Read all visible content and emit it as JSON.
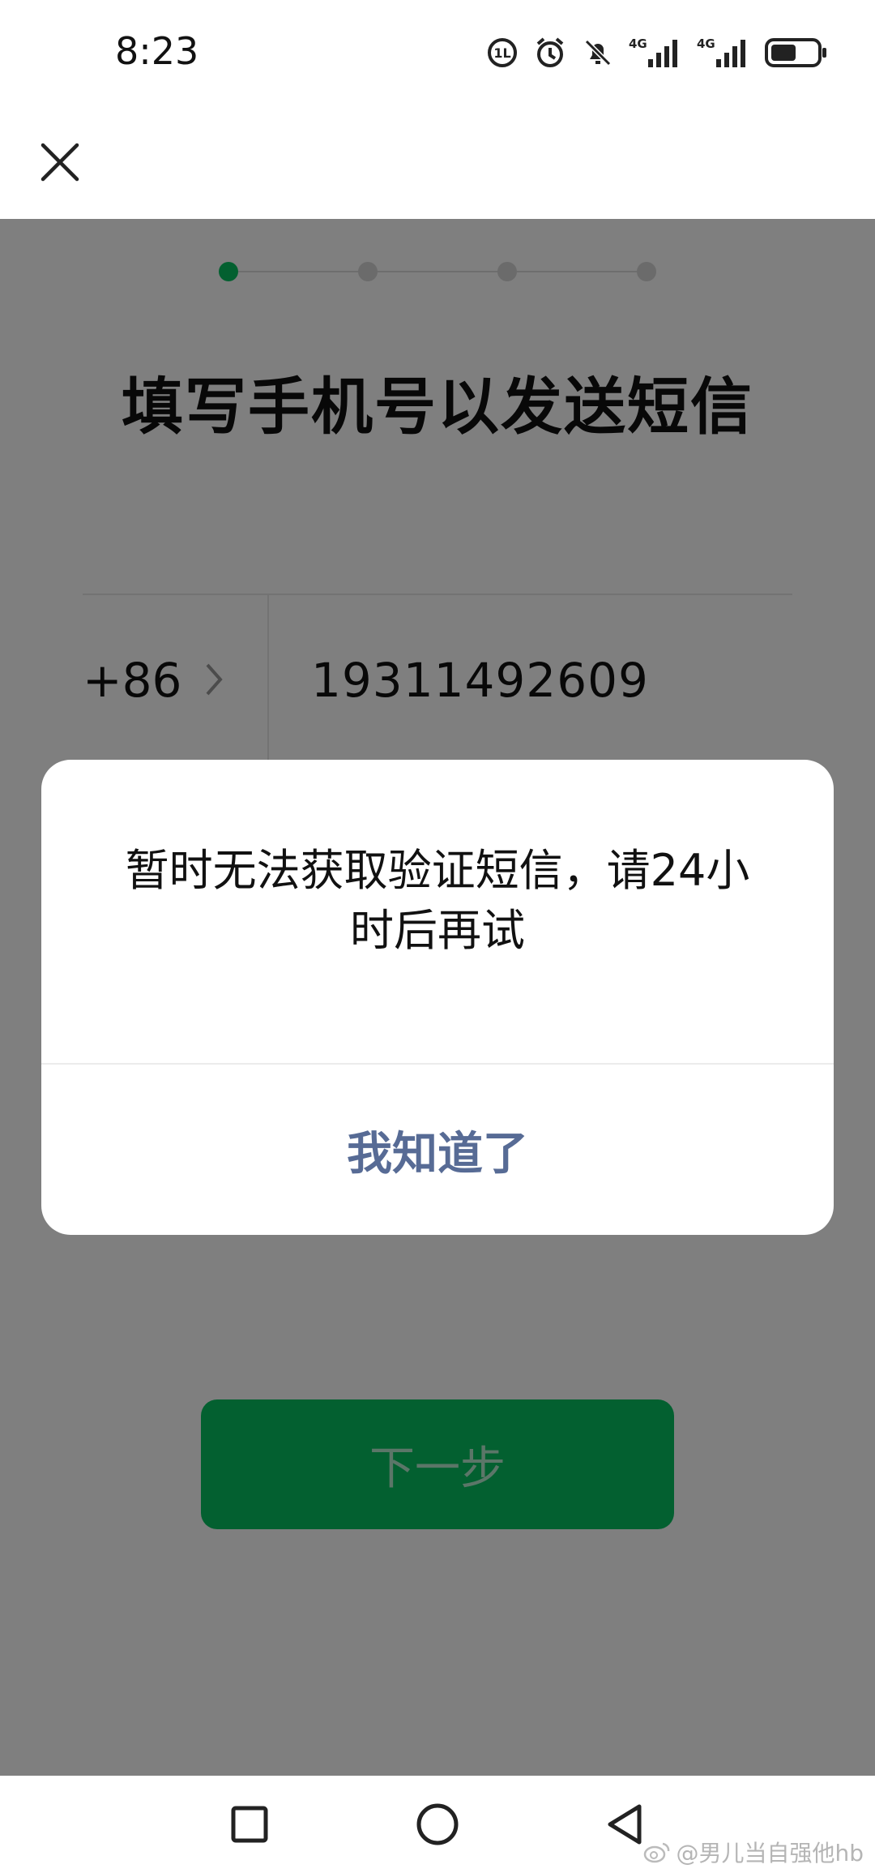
{
  "status_bar": {
    "time": "8:23",
    "net_label_1": "4G",
    "net_label_2": "4G",
    "battery_level": 0.55
  },
  "stepper": {
    "steps": 4,
    "active_index": 0,
    "accent": "#07c160"
  },
  "page": {
    "title": "填写手机号以发送短信",
    "country_code": "+86",
    "phone_number": "19311492609",
    "next_button": "下一步"
  },
  "dialog": {
    "message": "暂时无法获取验证短信，请24小时后再试",
    "confirm": "我知道了",
    "confirm_color": "#576b95"
  },
  "watermark": {
    "text": "@男儿当自强他hb"
  }
}
